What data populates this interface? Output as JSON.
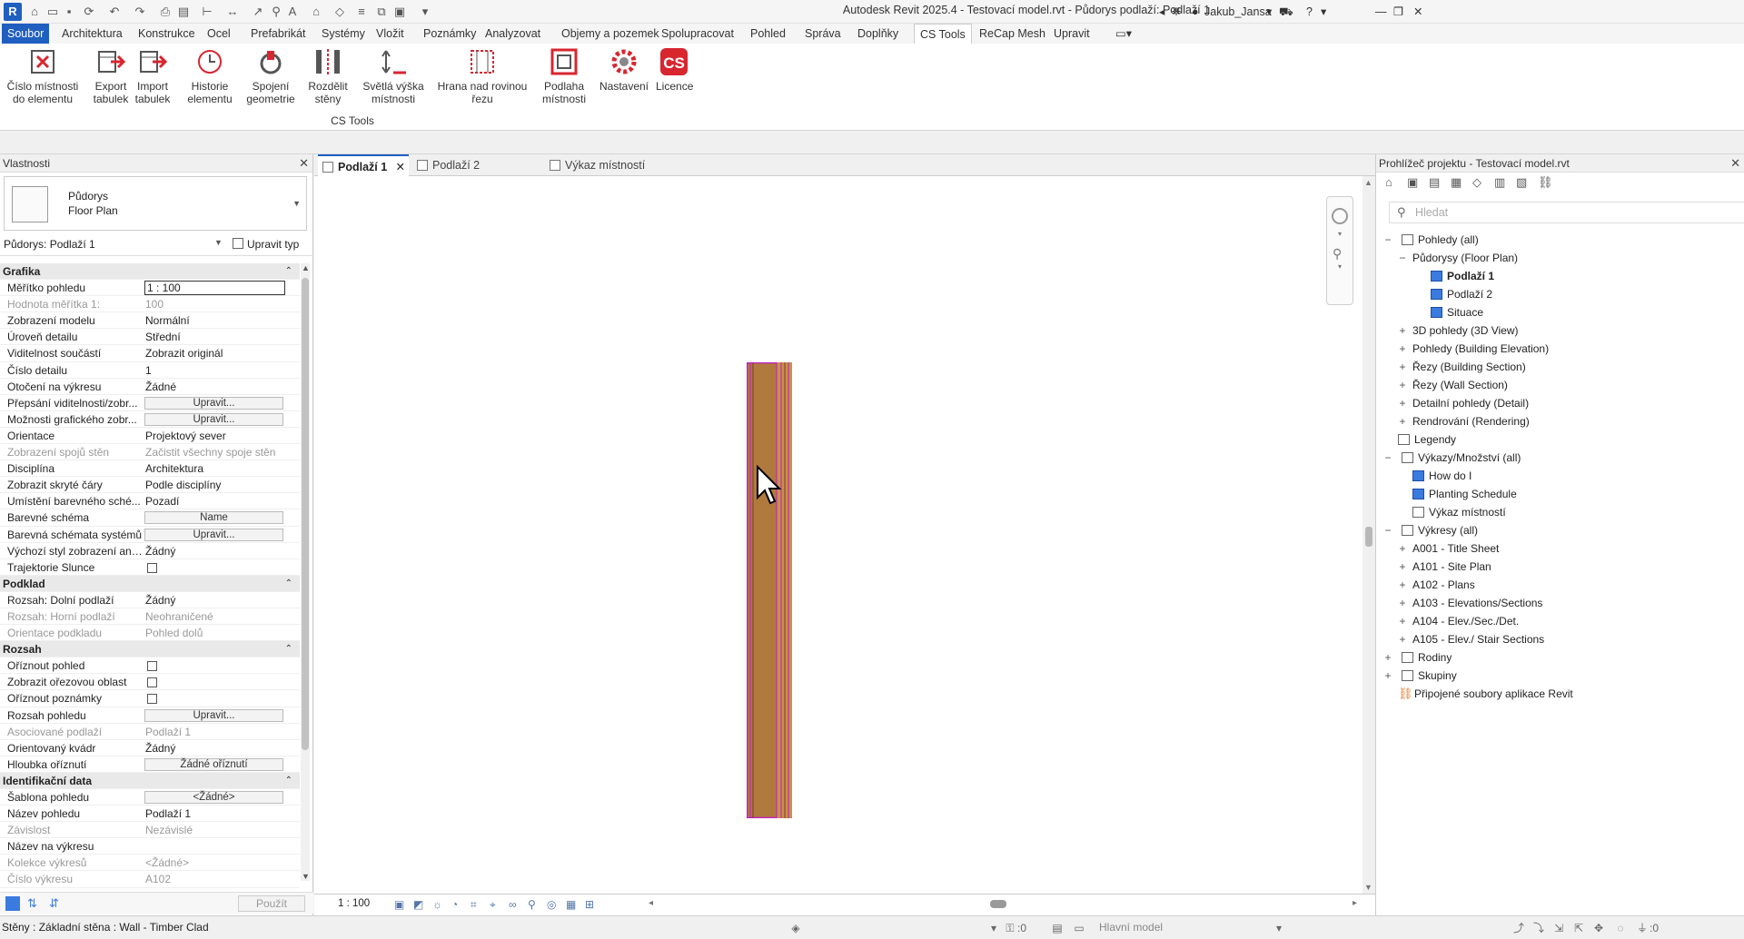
{
  "app": {
    "title": "Autodesk Revit 2025.4 - Testovací model.rvt - Půdorys podlaží: Podlaží 1",
    "user": "Jakub_Jansa",
    "logo": "R"
  },
  "ribbon_tabs": [
    "Soubor",
    "Architektura",
    "Konstrukce",
    "Ocel",
    "Prefabrikát",
    "Systémy",
    "Vložit",
    "Poznámky",
    "Analyzovat",
    "Objemy a pozemek",
    "Spolupracovat",
    "Pohled",
    "Správa",
    "Doplňky",
    "CS Tools",
    "ReCap Mesh",
    "Upravit"
  ],
  "ribbon_active": "CS Tools",
  "tools": [
    {
      "l1": "Číslo místnosti",
      "l2": "do elementu",
      "icon": "room-number-icon"
    },
    {
      "l1": "Export",
      "l2": "tabulek",
      "icon": "export-table-icon"
    },
    {
      "l1": "Import",
      "l2": "tabulek",
      "icon": "import-table-icon"
    },
    {
      "l1": "Historie",
      "l2": "elementu",
      "icon": "history-icon"
    },
    {
      "l1": "Spojení",
      "l2": "geometrie",
      "icon": "join-geometry-icon"
    },
    {
      "l1": "Rozdělit",
      "l2": "stěny",
      "icon": "split-walls-icon"
    },
    {
      "l1": "Světlá výška",
      "l2": "místnosti",
      "icon": "room-height-icon"
    },
    {
      "l1": "Hrana nad rovinou",
      "l2": "řezu",
      "icon": "edge-above-cut-icon"
    },
    {
      "l1": "Podlaha",
      "l2": "místnosti",
      "icon": "room-floor-icon"
    },
    {
      "l1": "Nastavení",
      "l2": "",
      "icon": "settings-icon"
    },
    {
      "l1": "Licence",
      "l2": "",
      "icon": "license-icon"
    }
  ],
  "panel_label": "CS Tools",
  "properties": {
    "title": "Vlastnosti",
    "type_l1": "Půdorys",
    "type_l2": "Floor Plan",
    "instance": "Půdorys: Podlaží 1",
    "edit_type": "Upravit typ",
    "apply": "Použít",
    "rows": [
      {
        "t": "sec",
        "n": "Grafika"
      },
      {
        "n": "Měřítko pohledu",
        "v": "1 : 100",
        "k": "edit"
      },
      {
        "n": "Hodnota měřítka    1:",
        "v": "100",
        "k": "dis"
      },
      {
        "n": "Zobrazení modelu",
        "v": "Normální"
      },
      {
        "n": "Úroveň detailu",
        "v": "Střední"
      },
      {
        "n": "Viditelnost součástí",
        "v": "Zobrazit originál"
      },
      {
        "n": "Číslo detailu",
        "v": "1"
      },
      {
        "n": "Otočení na výkresu",
        "v": "Žádné"
      },
      {
        "n": "Přepsání viditelnosti/zobr...",
        "v": "Upravit...",
        "k": "btn"
      },
      {
        "n": "Možnosti grafického zobr...",
        "v": "Upravit...",
        "k": "btn"
      },
      {
        "n": "Orientace",
        "v": "Projektový sever"
      },
      {
        "n": "Zobrazení spojů stěn",
        "v": "Začistit všechny spoje stěn",
        "k": "dis"
      },
      {
        "n": "Disciplína",
        "v": "Architektura"
      },
      {
        "n": "Zobrazit skryté čáry",
        "v": "Podle disciplíny"
      },
      {
        "n": "Umístění barevného sché...",
        "v": "Pozadí"
      },
      {
        "n": "Barevné schéma",
        "v": "Name",
        "k": "btn"
      },
      {
        "n": "Barevná schémata systémů",
        "v": "Upravit...",
        "k": "btn"
      },
      {
        "n": "Výchozí styl zobrazení ana...",
        "v": "Žádný"
      },
      {
        "n": "Trajektorie Slunce",
        "v": "",
        "k": "cb"
      },
      {
        "t": "sec",
        "n": "Podklad"
      },
      {
        "n": "Rozsah: Dolní podlaží",
        "v": "Žádný"
      },
      {
        "n": "Rozsah: Horní podlaží",
        "v": "Neohraničené",
        "k": "dis"
      },
      {
        "n": "Orientace podkladu",
        "v": "Pohled dolů",
        "k": "dis"
      },
      {
        "t": "sec",
        "n": "Rozsah"
      },
      {
        "n": "Oříznout pohled",
        "v": "",
        "k": "cb"
      },
      {
        "n": "Zobrazit ořezovou oblast",
        "v": "",
        "k": "cb"
      },
      {
        "n": "Oříznout poznámky",
        "v": "",
        "k": "cb"
      },
      {
        "n": "Rozsah pohledu",
        "v": "Upravit...",
        "k": "btn"
      },
      {
        "n": "Asociované podlaží",
        "v": "Podlaží 1",
        "k": "dis"
      },
      {
        "n": "Orientovaný kvádr",
        "v": "Žádný"
      },
      {
        "n": "Hloubka oříznutí",
        "v": "Žádné oříznutí",
        "k": "btn"
      },
      {
        "t": "sec",
        "n": "Identifikační data"
      },
      {
        "n": "Šablona pohledu",
        "v": "<Žádné>",
        "k": "btn"
      },
      {
        "n": "Název pohledu",
        "v": "Podlaží 1"
      },
      {
        "n": "Závislost",
        "v": "Nezávislé",
        "k": "dis"
      },
      {
        "n": "Název na výkresu",
        "v": ""
      },
      {
        "n": "Kolekce výkresů",
        "v": "<Žádné>",
        "k": "dis"
      },
      {
        "n": "Číslo výkresu",
        "v": "A102",
        "k": "dis"
      }
    ]
  },
  "view_tabs": [
    {
      "label": "Podlaží 1",
      "active": true
    },
    {
      "label": "Podlaží 2"
    },
    {
      "label": "Výkaz místností"
    }
  ],
  "view_scale": "1 : 100",
  "browser": {
    "title": "Prohlížeč projektu - Testovací model.rvt",
    "search_placeholder": "Hledat",
    "nodes": [
      {
        "d": 0,
        "tg": "−",
        "label": "Pohledy (all)",
        "ic": "views"
      },
      {
        "d": 1,
        "tg": "−",
        "label": "Půdorysy (Floor Plan)"
      },
      {
        "d": 2,
        "label": "Podlaží 1",
        "ic": "blue",
        "sel": true
      },
      {
        "d": 2,
        "label": "Podlaží 2",
        "ic": "blue"
      },
      {
        "d": 2,
        "label": "Situace",
        "ic": "blue"
      },
      {
        "d": 1,
        "tg": "+",
        "label": "3D pohledy (3D View)"
      },
      {
        "d": 1,
        "tg": "+",
        "label": "Pohledy (Building Elevation)"
      },
      {
        "d": 1,
        "tg": "+",
        "label": "Řezy (Building Section)"
      },
      {
        "d": 1,
        "tg": "+",
        "label": "Řezy (Wall Section)"
      },
      {
        "d": 1,
        "tg": "+",
        "label": "Detailní pohledy (Detail)"
      },
      {
        "d": 1,
        "tg": "+",
        "label": "Rendrování (Rendering)"
      },
      {
        "d": 0,
        "label": "Legendy",
        "ic": "plain",
        "x": 1
      },
      {
        "d": 0,
        "tg": "−",
        "label": "Výkazy/Množství (all)",
        "ic": "plain"
      },
      {
        "d": 1,
        "label": "How do I",
        "ic": "blue",
        "x": 1
      },
      {
        "d": 1,
        "label": "Planting Schedule",
        "ic": "blue",
        "x": 1
      },
      {
        "d": 1,
        "label": "Výkaz místností",
        "ic": "plain",
        "x": 1
      },
      {
        "d": 0,
        "tg": "−",
        "label": "Výkresy (all)",
        "ic": "plain"
      },
      {
        "d": 1,
        "tg": "+",
        "label": "A001 - Title Sheet"
      },
      {
        "d": 1,
        "tg": "+",
        "label": "A101 - Site Plan"
      },
      {
        "d": 1,
        "tg": "+",
        "label": "A102 - Plans"
      },
      {
        "d": 1,
        "tg": "+",
        "label": "A103 - Elevations/Sections"
      },
      {
        "d": 1,
        "tg": "+",
        "label": "A104 - Elev./Sec./Det."
      },
      {
        "d": 1,
        "tg": "+",
        "label": "A105 - Elev./ Stair Sections"
      },
      {
        "d": 0,
        "tg": "+",
        "label": "Rodiny",
        "ic": "plain"
      },
      {
        "d": 0,
        "tg": "+",
        "label": "Skupiny",
        "ic": "plain"
      },
      {
        "d": 0,
        "label": "Připojené soubory aplikace Revit",
        "ic": "link",
        "x": 1
      }
    ]
  },
  "status": {
    "text": "Stěny : Základní stěna : Wall - Timber Clad",
    "model": "Hlavní model",
    "sel_count": ":0",
    "filter_count": ":0"
  },
  "colors": {
    "accent": "#1f5fbf",
    "wall_fill": "#b07a3e",
    "wall_outline": "#c21ac8",
    "cs_red": "#d8262f"
  }
}
